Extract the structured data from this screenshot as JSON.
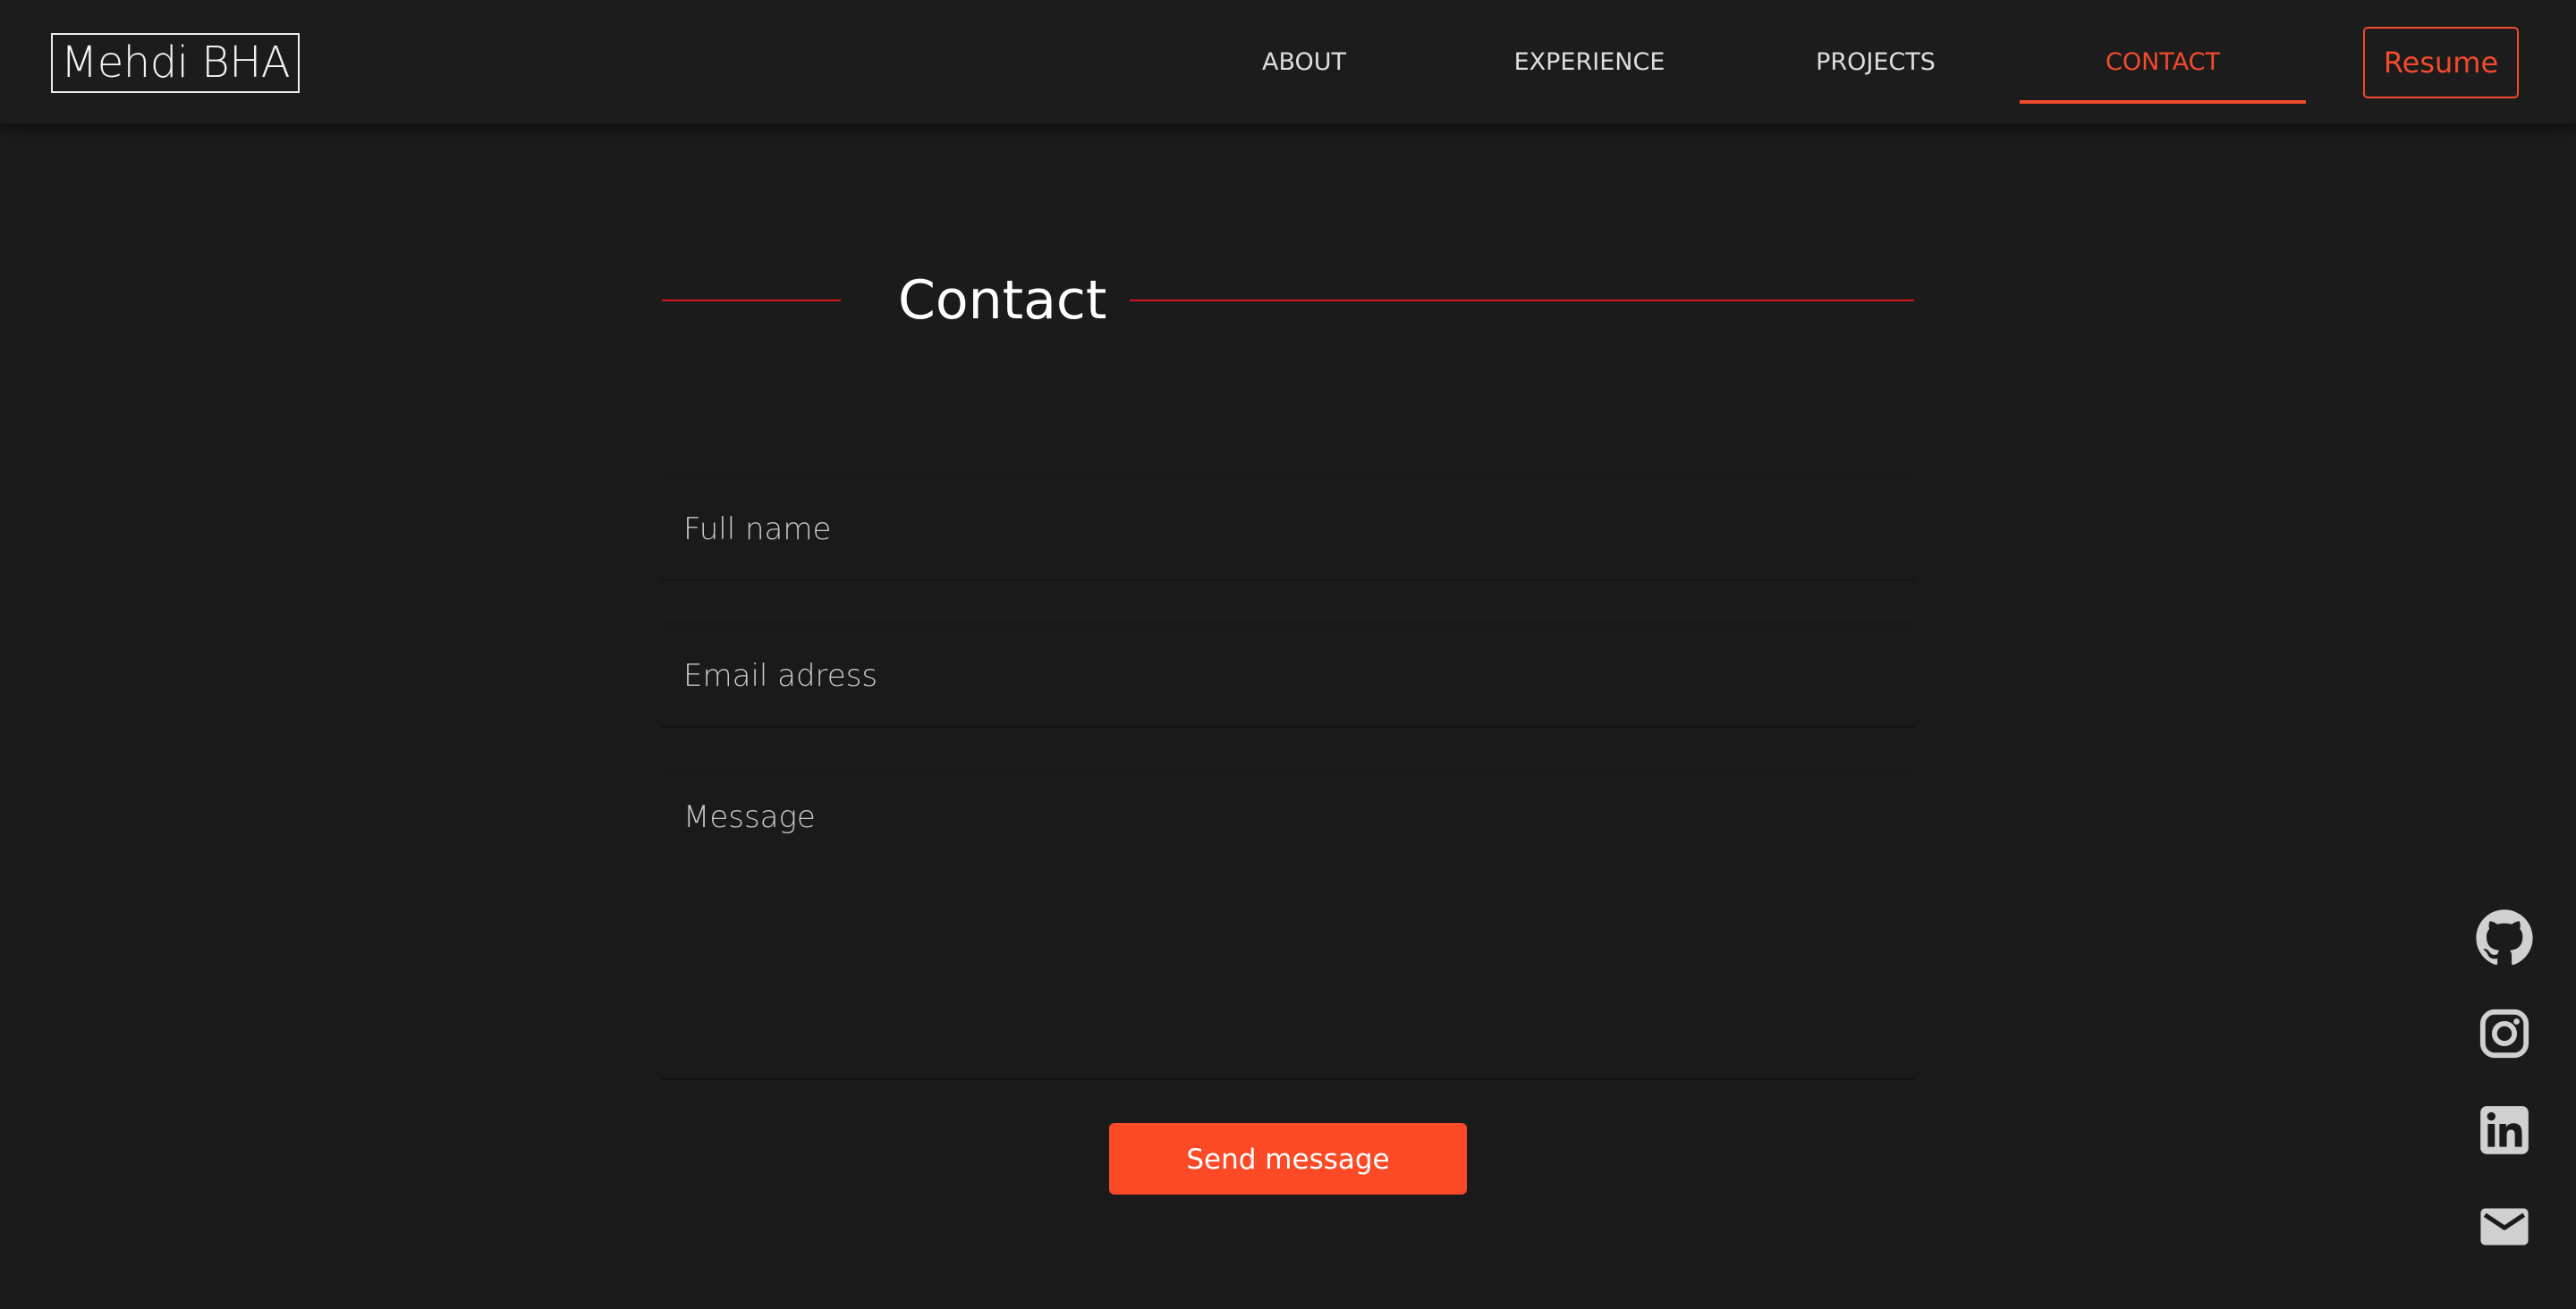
{
  "header": {
    "logo": "Mehdi BHA",
    "nav": [
      {
        "label": "ABOUT"
      },
      {
        "label": "EXPERIENCE"
      },
      {
        "label": "PROJECTS"
      },
      {
        "label": "CONTACT",
        "active": true
      }
    ],
    "resume_label": "Resume"
  },
  "contact": {
    "title": "Contact",
    "fields": {
      "full_name_placeholder": "Full name",
      "email_placeholder": "Email adress",
      "message_placeholder": "Message"
    },
    "send_label": "Send message"
  },
  "social": [
    {
      "icon": "github-icon"
    },
    {
      "icon": "instagram-icon"
    },
    {
      "icon": "linkedin-icon"
    },
    {
      "icon": "mail-icon"
    }
  ],
  "colors": {
    "background": "#1b1b1b",
    "accent": "#f24a2c",
    "button": "#fc4a26",
    "title_rule": "#d4141a",
    "icon": "#d0d0d0"
  }
}
